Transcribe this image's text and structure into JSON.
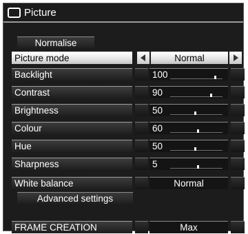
{
  "menu": {
    "title": "Picture",
    "normalise_label": "Normalise",
    "advanced_label": "Advanced settings",
    "picture_mode": {
      "label": "Picture mode",
      "value": "Normal"
    },
    "sliders": [
      {
        "label": "Backlight",
        "value": "100",
        "level": 0.85
      },
      {
        "label": "Contrast",
        "value": "90",
        "level": 0.78
      },
      {
        "label": "Brightness",
        "value": "50",
        "level": 0.48
      },
      {
        "label": "Colour",
        "value": "60",
        "level": 0.52
      },
      {
        "label": "Hue",
        "value": "50",
        "level": 0.48
      },
      {
        "label": "Sharpness",
        "value": "5",
        "level": 0.52
      }
    ],
    "white_balance": {
      "label": "White balance",
      "value": "Normal"
    },
    "frame_creation": {
      "label": "FRAME CREATION",
      "value": "Max"
    }
  }
}
